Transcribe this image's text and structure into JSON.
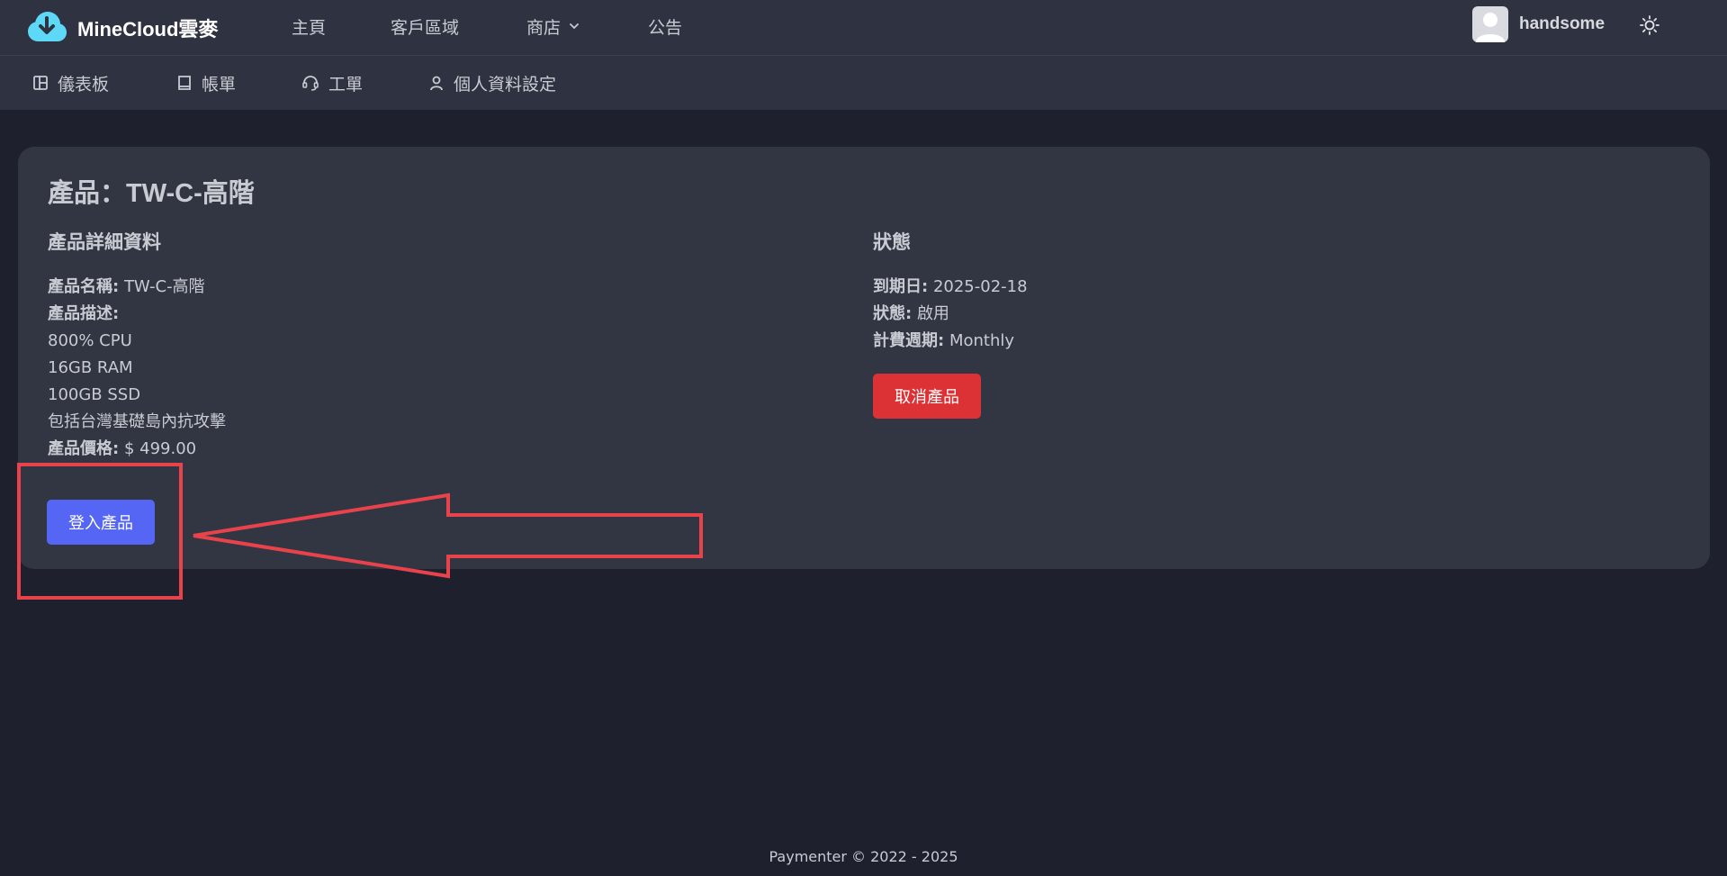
{
  "brand": {
    "name": "MineCloud雲麥",
    "logo_icon": "cloud-download-icon",
    "logo_color": "#5dd9f7"
  },
  "topnav": {
    "items": [
      {
        "label": "主頁"
      },
      {
        "label": "客戶區域"
      },
      {
        "label": "商店",
        "icon": "chevron-down-icon"
      },
      {
        "label": "公告"
      }
    ],
    "user": {
      "name": "handsome",
      "avatar_icon": "avatar-placeholder-icon"
    },
    "theme_icon": "sun-icon"
  },
  "subnav": {
    "items": [
      {
        "label": "儀表板",
        "icon": "dashboard-icon"
      },
      {
        "label": "帳單",
        "icon": "invoice-icon"
      },
      {
        "label": "工單",
        "icon": "headset-icon"
      },
      {
        "label": "個人資料設定",
        "icon": "user-icon"
      }
    ]
  },
  "product": {
    "title": "產品：TW-C-高階",
    "details_heading": "產品詳細資料",
    "name_label": "產品名稱:",
    "name_value": "TW-C-高階",
    "desc_label": "產品描述:",
    "desc_lines": [
      "800% CPU",
      "16GB RAM",
      "100GB SSD",
      "包括台灣基礎島內抗攻擊"
    ],
    "price_label": "產品價格:",
    "price_value": "$ 499.00",
    "login_button": "登入產品"
  },
  "status": {
    "heading": "狀態",
    "due_label": "到期日:",
    "due_value": "2025-02-18",
    "status_label": "狀態:",
    "status_value": "啟用",
    "cycle_label": "計費週期:",
    "cycle_value": "Monthly",
    "cancel_button": "取消產品"
  },
  "colors": {
    "accent": "#5566f4",
    "danger": "#dc3236",
    "annotation": "#e8434a"
  },
  "footer": {
    "text": "Paymenter © 2022 - 2025"
  }
}
